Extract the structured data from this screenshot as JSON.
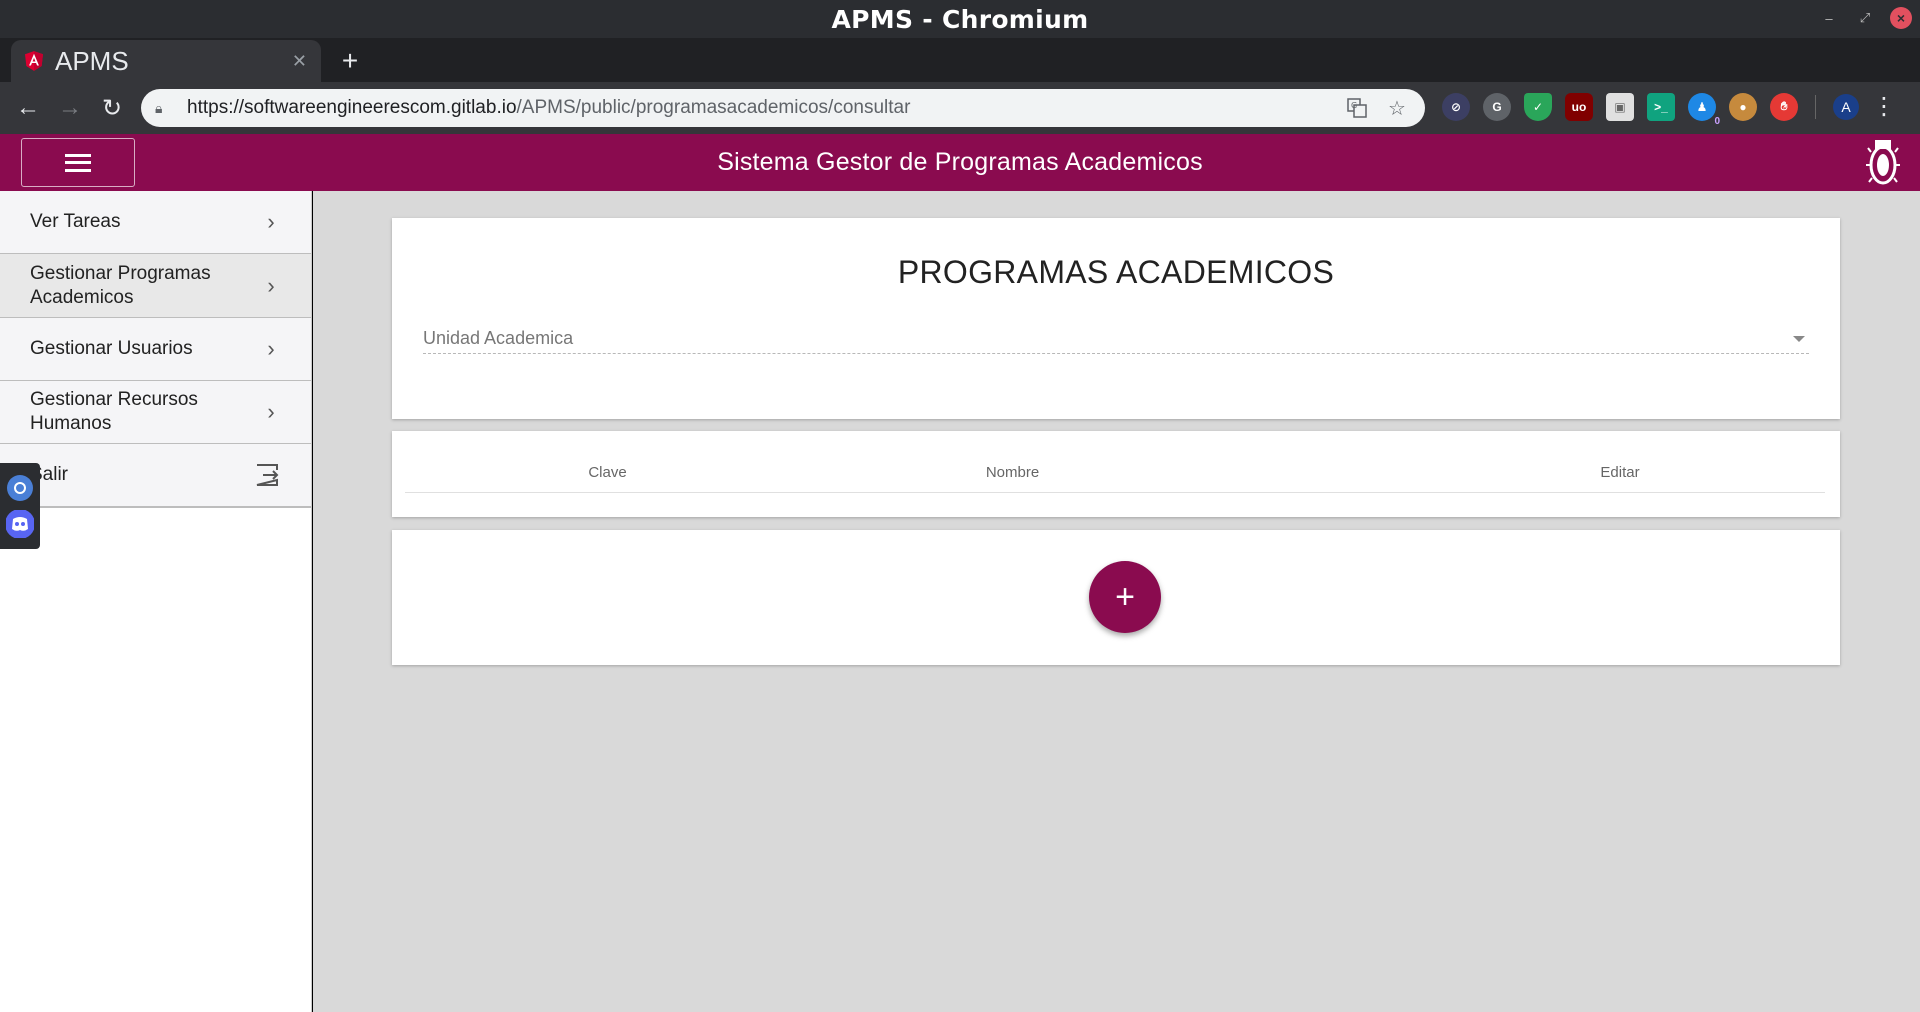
{
  "window": {
    "title": "APMS - Chromium"
  },
  "browser": {
    "tab_title": "APMS",
    "url_host": "https://softwareengineerescom.gitlab.io",
    "url_path": "/APMS/public/programasacademicos/consultar",
    "extension_badge": "0",
    "avatar_letter": "A"
  },
  "app": {
    "title": "Sistema Gestor de Programas Academicos",
    "accent": "#8a0b4f"
  },
  "sidebar": {
    "items": [
      {
        "label": "Ver Tareas"
      },
      {
        "label": "Gestionar Programas Academicos"
      },
      {
        "label": "Gestionar Usuarios"
      },
      {
        "label": "Gestionar Recursos Humanos"
      },
      {
        "label": "Salir"
      }
    ]
  },
  "main": {
    "heading": "PROGRAMAS ACADEMICOS",
    "select_placeholder": "Unidad Academica",
    "table_headers": [
      "Clave",
      "Nombre",
      "Editar"
    ],
    "fab_symbol": "+"
  }
}
